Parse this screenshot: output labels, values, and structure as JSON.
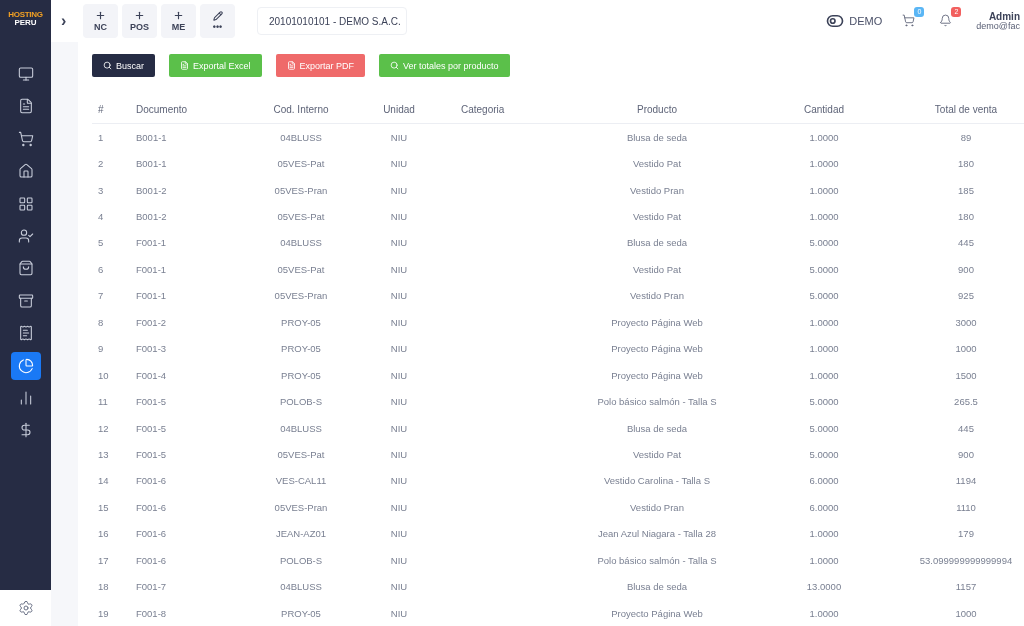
{
  "logo": {
    "line1": "HOSTING",
    "line2": "PERU"
  },
  "sidebar": {
    "items": [
      {
        "selected": false
      },
      {
        "selected": false
      },
      {
        "selected": false
      },
      {
        "selected": false
      },
      {
        "selected": false
      },
      {
        "selected": false
      },
      {
        "selected": false
      },
      {
        "selected": false
      },
      {
        "selected": false
      },
      {
        "selected": true
      },
      {
        "selected": false
      },
      {
        "selected": false
      }
    ]
  },
  "topbar": {
    "toggle": "›",
    "quick_actions": [
      {
        "kind": "plus",
        "label": "NC"
      },
      {
        "kind": "plus",
        "label": "POS"
      },
      {
        "kind": "plus",
        "label": "ME"
      },
      {
        "kind": "edit",
        "label": "•••"
      }
    ],
    "company_select": {
      "value": "20101010101 - DEMO S.A.C."
    },
    "mode": "DEMO",
    "cart_badge": {
      "count": "0",
      "color": "#5ab6f5"
    },
    "bell_badge": {
      "count": "2",
      "color": "#f2605f"
    },
    "user": {
      "name": "Admin",
      "email": "demo@fac"
    }
  },
  "actions": [
    {
      "kind": "search",
      "label": "Buscar"
    },
    {
      "kind": "excel",
      "label": "Exportal Excel"
    },
    {
      "kind": "pdf",
      "label": "Exportar PDF"
    },
    {
      "kind": "totals",
      "label": "Ver totales por producto"
    }
  ],
  "table": {
    "columns": [
      "#",
      "Documento",
      "Cod. Interno",
      "Unidad",
      "Categoria",
      "Producto",
      "Cantidad",
      "Total de venta"
    ],
    "rows": [
      [
        "1",
        "B001-1",
        "04BLUSS",
        "NIU",
        "",
        "Blusa de seda",
        "1.0000",
        "89"
      ],
      [
        "2",
        "B001-1",
        "05VES-Pat",
        "NIU",
        "",
        "Vestido Pat",
        "1.0000",
        "180"
      ],
      [
        "3",
        "B001-2",
        "05VES-Pran",
        "NIU",
        "",
        "Vestido Pran",
        "1.0000",
        "185"
      ],
      [
        "4",
        "B001-2",
        "05VES-Pat",
        "NIU",
        "",
        "Vestido Pat",
        "1.0000",
        "180"
      ],
      [
        "5",
        "F001-1",
        "04BLUSS",
        "NIU",
        "",
        "Blusa de seda",
        "5.0000",
        "445"
      ],
      [
        "6",
        "F001-1",
        "05VES-Pat",
        "NIU",
        "",
        "Vestido Pat",
        "5.0000",
        "900"
      ],
      [
        "7",
        "F001-1",
        "05VES-Pran",
        "NIU",
        "",
        "Vestido Pran",
        "5.0000",
        "925"
      ],
      [
        "8",
        "F001-2",
        "PROY-05",
        "NIU",
        "",
        "Proyecto Página Web",
        "1.0000",
        "3000"
      ],
      [
        "9",
        "F001-3",
        "PROY-05",
        "NIU",
        "",
        "Proyecto Página Web",
        "1.0000",
        "1000"
      ],
      [
        "10",
        "F001-4",
        "PROY-05",
        "NIU",
        "",
        "Proyecto Página Web",
        "1.0000",
        "1500"
      ],
      [
        "11",
        "F001-5",
        "POLOB-S",
        "NIU",
        "",
        "Polo básico salmón - Talla S",
        "5.0000",
        "265.5"
      ],
      [
        "12",
        "F001-5",
        "04BLUSS",
        "NIU",
        "",
        "Blusa de seda",
        "5.0000",
        "445"
      ],
      [
        "13",
        "F001-5",
        "05VES-Pat",
        "NIU",
        "",
        "Vestido Pat",
        "5.0000",
        "900"
      ],
      [
        "14",
        "F001-6",
        "VES-CAL11",
        "NIU",
        "",
        "Vestido Carolina - Talla S",
        "6.0000",
        "1194"
      ],
      [
        "15",
        "F001-6",
        "05VES-Pran",
        "NIU",
        "",
        "Vestido Pran",
        "6.0000",
        "1110"
      ],
      [
        "16",
        "F001-6",
        "JEAN-AZ01",
        "NIU",
        "",
        "Jean Azul Niagara - Talla 28",
        "1.0000",
        "179"
      ],
      [
        "17",
        "F001-6",
        "POLOB-S",
        "NIU",
        "",
        "Polo básico salmón - Talla S",
        "1.0000",
        "53.099999999999994"
      ],
      [
        "18",
        "F001-7",
        "04BLUSS",
        "NIU",
        "",
        "Blusa de seda",
        "13.0000",
        "1157"
      ],
      [
        "19",
        "F001-8",
        "PROY-05",
        "NIU",
        "",
        "Proyecto Página Web",
        "1.0000",
        "1000"
      ]
    ]
  }
}
